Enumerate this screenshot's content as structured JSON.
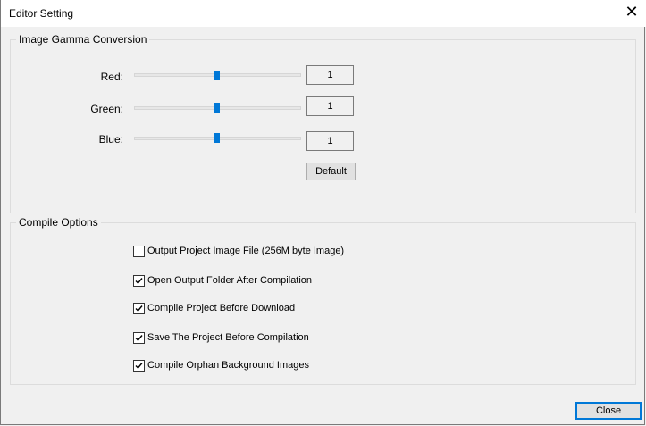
{
  "window": {
    "title": "Editor Setting",
    "close_glyph": "✕"
  },
  "gamma": {
    "title": "Image Gamma Conversion",
    "channels": [
      {
        "label": "Red:",
        "value": "1",
        "level": 0.5
      },
      {
        "label": "Green:",
        "value": "1",
        "level": 0.5
      },
      {
        "label": "Blue:",
        "value": "1",
        "level": 0.5
      }
    ],
    "default_label": "Default"
  },
  "compile": {
    "title": "Compile Options",
    "options": [
      {
        "label": "Output Project Image File (256M byte Image)",
        "checked": false
      },
      {
        "label": "Open Output Folder After Compilation",
        "checked": true
      },
      {
        "label": "Compile Project Before Download",
        "checked": true
      },
      {
        "label": "Save The Project Before Compilation",
        "checked": true
      },
      {
        "label": "Compile Orphan Background Images",
        "checked": true
      }
    ]
  },
  "footer": {
    "close_label": "Close"
  },
  "colors": {
    "accent": "#0078d7",
    "background": "#f0f0f0"
  }
}
